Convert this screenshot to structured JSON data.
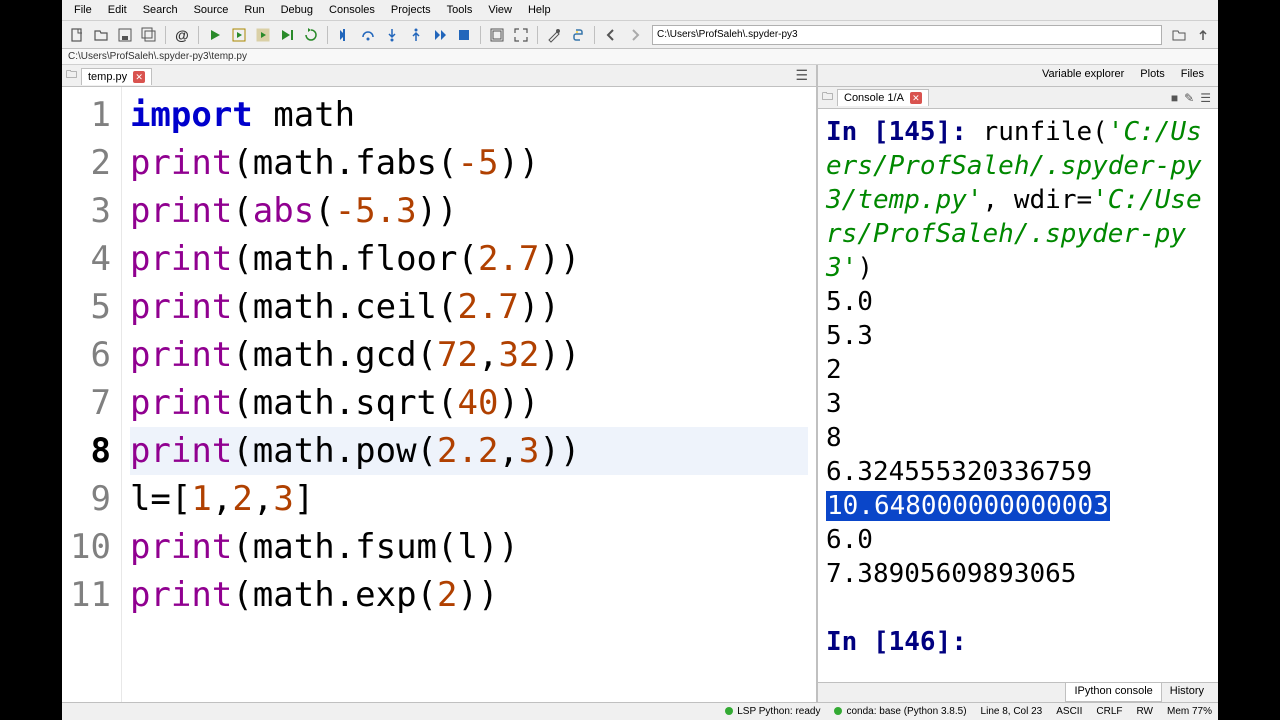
{
  "menu": {
    "file": "File",
    "edit": "Edit",
    "search": "Search",
    "source": "Source",
    "run": "Run",
    "debug": "Debug",
    "consoles": "Consoles",
    "projects": "Projects",
    "tools": "Tools",
    "view": "View",
    "help": "Help"
  },
  "workdir": "C:\\Users\\ProfSaleh\\.spyder-py3",
  "pathbar": "C:\\Users\\ProfSaleh\\.spyder-py3\\temp.py",
  "editor": {
    "tab_name": "temp.py",
    "current_line": 8,
    "lines": [
      {
        "n": 1,
        "tokens": [
          {
            "t": "import",
            "c": "kw"
          },
          {
            "t": " math",
            "c": ""
          }
        ]
      },
      {
        "n": 2,
        "tokens": [
          {
            "t": "print",
            "c": "builtin"
          },
          {
            "t": "(math.fabs(",
            "c": ""
          },
          {
            "t": "-5",
            "c": "num"
          },
          {
            "t": "))",
            "c": ""
          }
        ]
      },
      {
        "n": 3,
        "tokens": [
          {
            "t": "print",
            "c": "builtin"
          },
          {
            "t": "(",
            "c": ""
          },
          {
            "t": "abs",
            "c": "builtin"
          },
          {
            "t": "(",
            "c": ""
          },
          {
            "t": "-5.3",
            "c": "num"
          },
          {
            "t": "))",
            "c": ""
          }
        ]
      },
      {
        "n": 4,
        "tokens": [
          {
            "t": "print",
            "c": "builtin"
          },
          {
            "t": "(math.floor(",
            "c": ""
          },
          {
            "t": "2.7",
            "c": "num"
          },
          {
            "t": "))",
            "c": ""
          }
        ]
      },
      {
        "n": 5,
        "tokens": [
          {
            "t": "print",
            "c": "builtin"
          },
          {
            "t": "(math.ceil(",
            "c": ""
          },
          {
            "t": "2.7",
            "c": "num"
          },
          {
            "t": "))",
            "c": ""
          }
        ]
      },
      {
        "n": 6,
        "tokens": [
          {
            "t": "print",
            "c": "builtin"
          },
          {
            "t": "(math.gcd(",
            "c": ""
          },
          {
            "t": "72",
            "c": "num"
          },
          {
            "t": ",",
            "c": ""
          },
          {
            "t": "32",
            "c": "num"
          },
          {
            "t": "))",
            "c": ""
          }
        ]
      },
      {
        "n": 7,
        "tokens": [
          {
            "t": "print",
            "c": "builtin"
          },
          {
            "t": "(math.sqrt(",
            "c": ""
          },
          {
            "t": "40",
            "c": "num"
          },
          {
            "t": "))",
            "c": ""
          }
        ]
      },
      {
        "n": 8,
        "tokens": [
          {
            "t": "print",
            "c": "builtin"
          },
          {
            "t": "(math.pow(",
            "c": ""
          },
          {
            "t": "2.2",
            "c": "num"
          },
          {
            "t": ",",
            "c": ""
          },
          {
            "t": "3",
            "c": "num"
          },
          {
            "t": "))",
            "c": ""
          }
        ]
      },
      {
        "n": 9,
        "tokens": [
          {
            "t": "l=[",
            "c": ""
          },
          {
            "t": "1",
            "c": "num"
          },
          {
            "t": ",",
            "c": ""
          },
          {
            "t": "2",
            "c": "num"
          },
          {
            "t": ",",
            "c": ""
          },
          {
            "t": "3",
            "c": "num"
          },
          {
            "t": "]",
            "c": ""
          }
        ]
      },
      {
        "n": 10,
        "tokens": [
          {
            "t": "print",
            "c": "builtin"
          },
          {
            "t": "(math.fsum(l))",
            "c": ""
          }
        ]
      },
      {
        "n": 11,
        "tokens": [
          {
            "t": "print",
            "c": "builtin"
          },
          {
            "t": "(math.exp(",
            "c": ""
          },
          {
            "t": "2",
            "c": "num"
          },
          {
            "t": "))",
            "c": ""
          }
        ]
      }
    ]
  },
  "right_tabs": {
    "var": "Variable explorer",
    "plots": "Plots",
    "files": "Files"
  },
  "console": {
    "tab_name": "Console 1/A",
    "in_prompt_1": "In [",
    "in_num_1": "145",
    "in_prompt_1b": "]: ",
    "cmd": "runfile(",
    "str1": "'C:/Users/ProfSaleh/.spyder-py3/temp.py'",
    "cmd_mid": ", wdir=",
    "str2": "'C:/Users/ProfSaleh/.spyder-py3'",
    "cmd_end": ")",
    "out": [
      "5.0",
      "5.3",
      "2",
      "3",
      "8",
      "6.324555320336759"
    ],
    "out_hl": "10.648000000000003",
    "out2": [
      "6.0",
      "7.38905609893065"
    ],
    "in_prompt_2": "In [",
    "in_num_2": "146",
    "in_prompt_2b": "]: "
  },
  "bottom_tabs": {
    "ipy": "IPython console",
    "hist": "History"
  },
  "status": {
    "lsp": "LSP Python: ready",
    "conda": "conda: base (Python 3.8.5)",
    "pos": "Line 8, Col 23",
    "enc": "ASCII",
    "eol": "CRLF",
    "rw": "RW",
    "mem": "Mem 77%"
  }
}
